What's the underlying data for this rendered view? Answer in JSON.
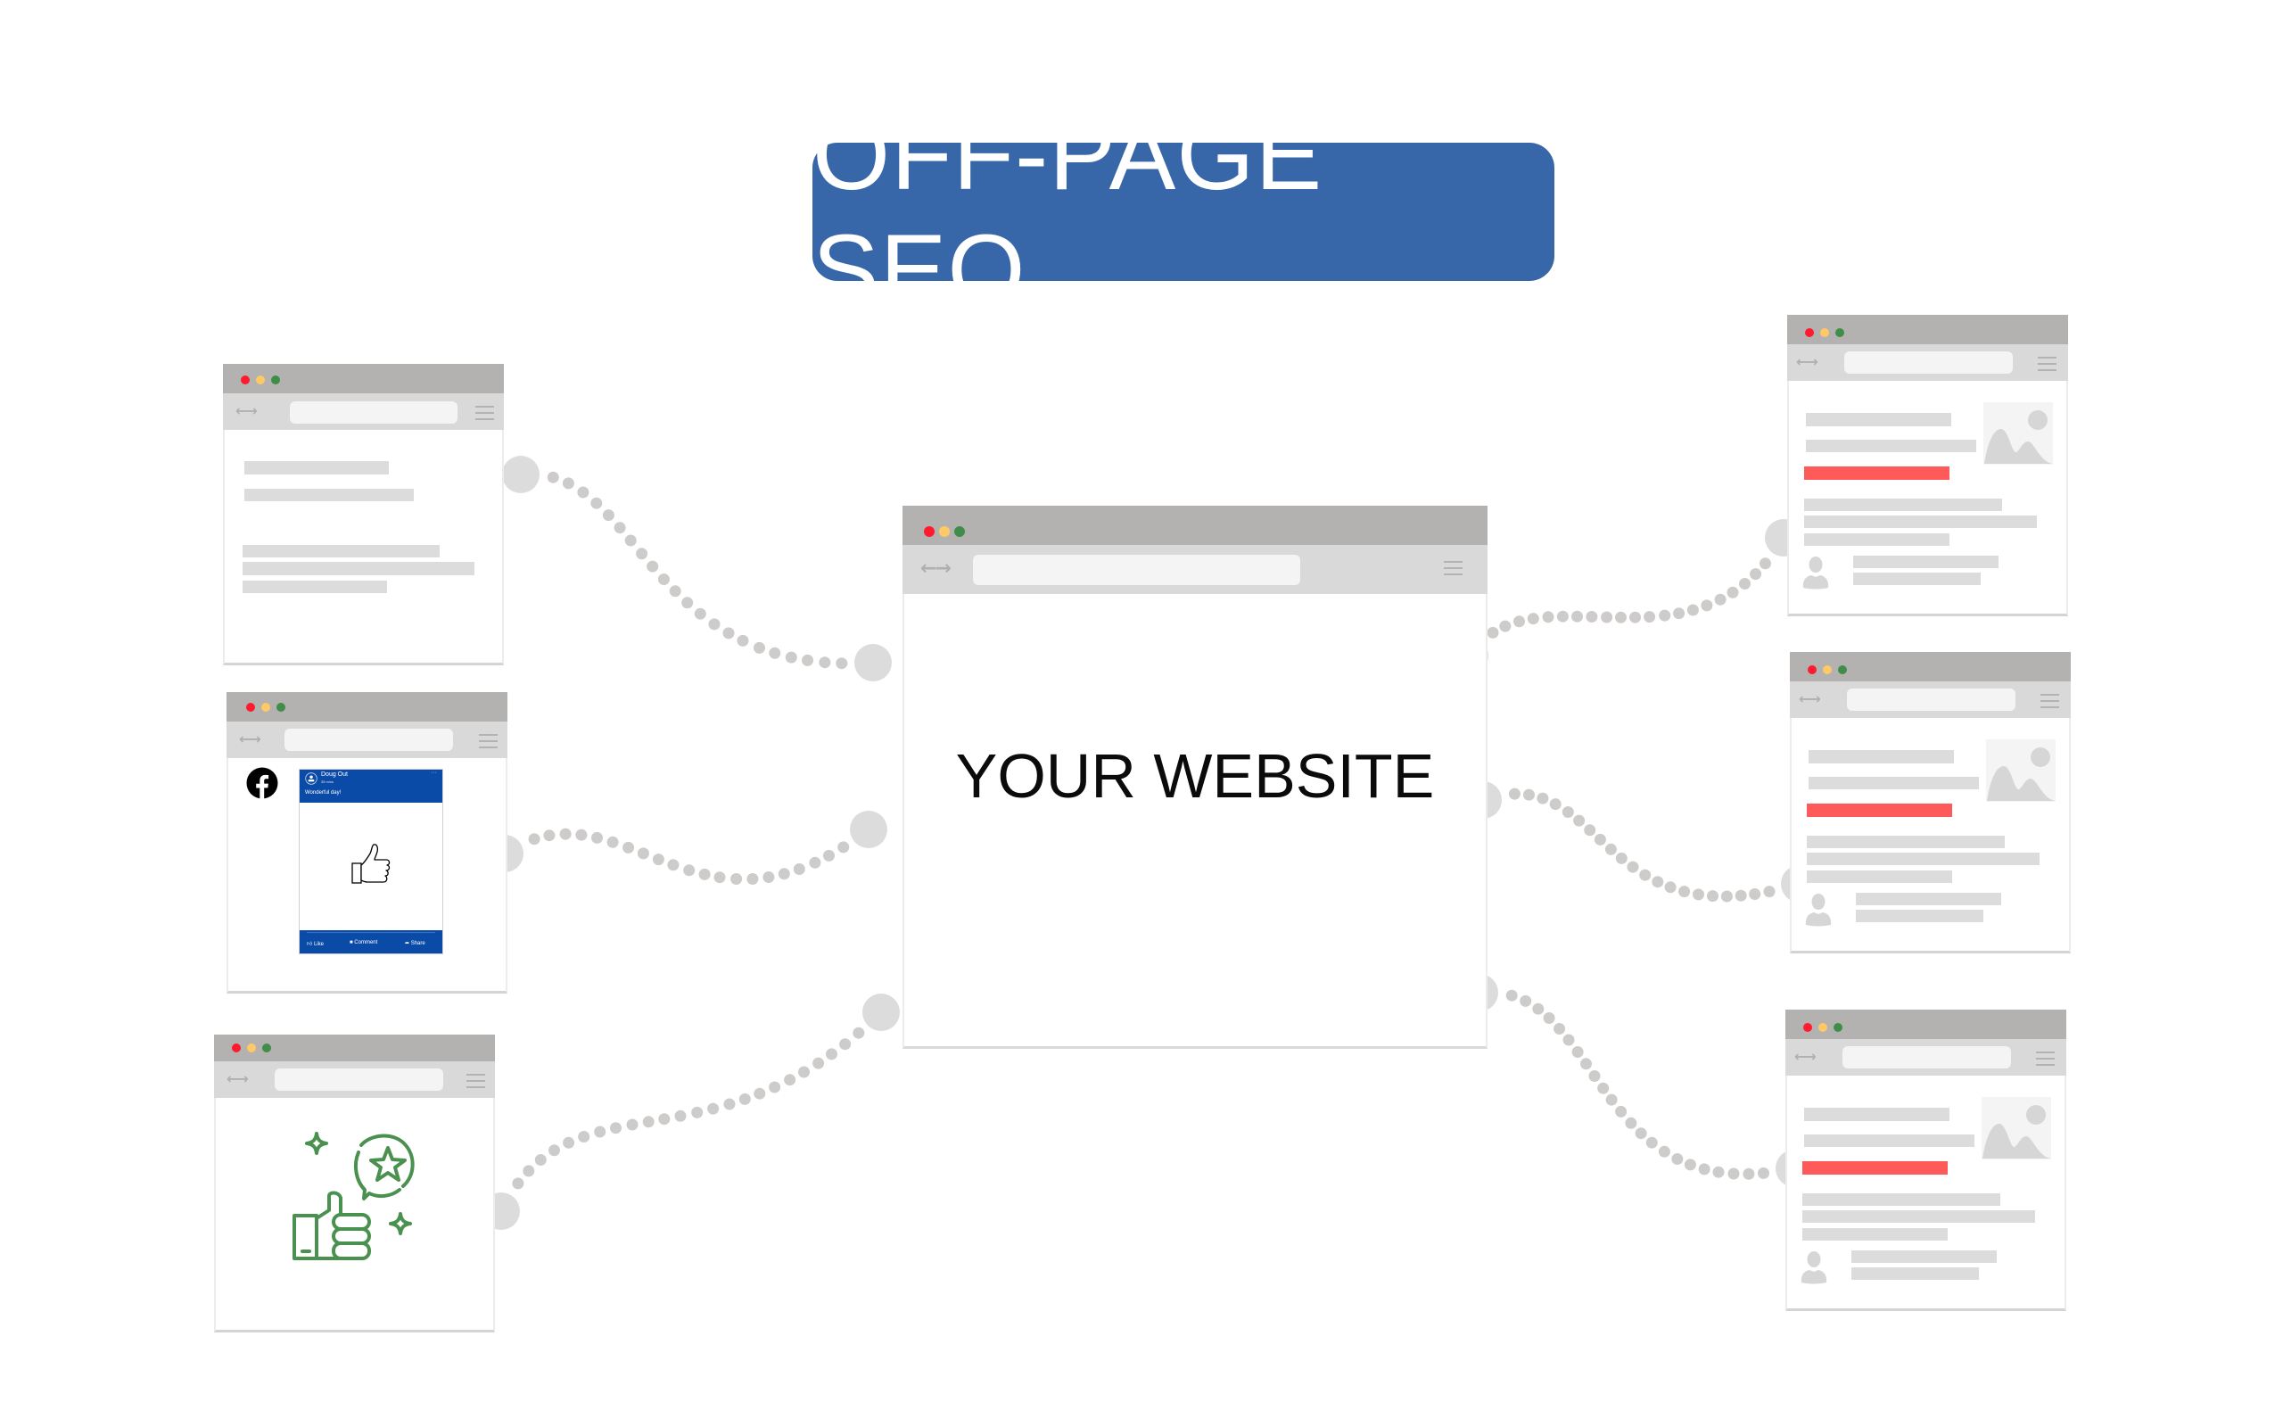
{
  "title": "OFF-PAGE SEO",
  "center_site": {
    "label": "YOUR WEBSITE"
  },
  "colors": {
    "banner": "#3767a8",
    "titlebar": "#b3b2b0",
    "toolbar": "#d9d9d9",
    "address_bar": "#f4f4f4",
    "placeholder_line": "#dcdcdc",
    "highlight_line": "#ff5a5a",
    "connector_dot": "#cdcccb",
    "connector_node": "#dcdcdc",
    "traffic_red": "#ff1a2e",
    "traffic_yellow": "#ffc966",
    "traffic_green": "#3f8d48",
    "facebook_blue": "#0a4ba8",
    "review_icon_green": "#4a9150"
  },
  "left_sources": [
    {
      "kind": "text-page"
    },
    {
      "kind": "facebook-post",
      "platform_icon": "facebook-icon",
      "post": {
        "author": "Doug Out",
        "time": "35 mins",
        "text": "Wonderful day!",
        "image_icon": "thumbs-up-icon",
        "actions": [
          "Like",
          "Comment",
          "Share"
        ]
      }
    },
    {
      "kind": "review",
      "icon": "thumbs-up-star-review-icon"
    }
  ],
  "right_sources": [
    {
      "kind": "article-page"
    },
    {
      "kind": "article-page"
    },
    {
      "kind": "article-page"
    }
  ]
}
